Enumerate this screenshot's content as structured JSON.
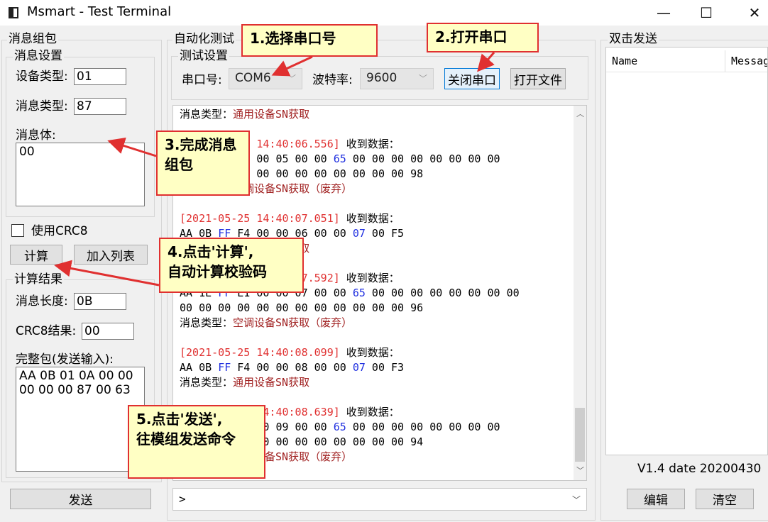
{
  "window": {
    "title": "Msmart - Test Terminal",
    "minimize": "—",
    "maximize": "☐",
    "close": "✕"
  },
  "left": {
    "group_title": "消息组包",
    "settings_title": "消息设置",
    "device_type_label": "设备类型:",
    "device_type_value": "01",
    "msg_type_label": "消息类型:",
    "msg_type_value": "87",
    "msg_body_label": "消息体:",
    "msg_body_value": "00",
    "crc_checkbox_label": "使用CRC8",
    "crc_checked": false,
    "calc_button": "计算",
    "add_list_button": "加入列表",
    "result_title": "计算结果",
    "msg_len_label": "消息长度:",
    "msg_len_value": "0B",
    "crc_result_label": "CRC8结果:",
    "crc_result_value": "00",
    "full_packet_label": "完整包(发送输入):",
    "full_packet_value": "AA 0B 01 0A 00 00\n00 00 00 87 00 63",
    "send_button": "发送"
  },
  "middle": {
    "group_title": "自动化测试",
    "settings_title": "测试设置",
    "port_label": "串口号:",
    "port_value": "COM6",
    "baud_label": "波特率:",
    "baud_value": "9600",
    "close_port_button": "关闭串口",
    "open_file_button": "打开文件",
    "send_input_value": ">"
  },
  "log": [
    {
      "type": "msgtype",
      "prefix": "消息类型：",
      "text": "通用设备SN获取"
    },
    {
      "type": "blank"
    },
    {
      "type": "ts",
      "ts": "[2021-05-25 14:40:06.556]",
      "suffix": " 收到数据："
    },
    {
      "type": "hex",
      "parts": [
        [
          "",
          "AA 1E 01 00 00 05 00 00 "
        ],
        [
          "b",
          "65"
        ],
        [
          "",
          " 00 00 00 00 00 00 00 00"
        ]
      ]
    },
    {
      "type": "hex",
      "parts": [
        [
          "",
          "00 00 00 00 00 00 00 00 00 00 00 00 98"
        ]
      ]
    },
    {
      "type": "msgtype",
      "prefix": "消息类型：",
      "text": "空调设备SN获取（废弃）"
    },
    {
      "type": "blank"
    },
    {
      "type": "ts",
      "ts": "[2021-05-25 14:40:07.051]",
      "suffix": " 收到数据："
    },
    {
      "type": "hex",
      "parts": [
        [
          "",
          "AA 0B "
        ],
        [
          "b",
          "FF"
        ],
        [
          "",
          " F4 00 00 06 00 00 "
        ],
        [
          "b",
          "07"
        ],
        [
          "",
          " 00 F5"
        ]
      ]
    },
    {
      "type": "msgtype",
      "prefix": "消息类型：",
      "text": "通用设备SN获取"
    },
    {
      "type": "blank"
    },
    {
      "type": "ts",
      "ts": "[2021-05-25 14:40:07.592]",
      "suffix": " 收到数据："
    },
    {
      "type": "hex",
      "parts": [
        [
          "",
          "AA 1E "
        ],
        [
          "b",
          "FF"
        ],
        [
          "",
          " E1 00 00 07 00 00 "
        ],
        [
          "b",
          "65"
        ],
        [
          "",
          " 00 00 00 00 00 00 00 00"
        ]
      ]
    },
    {
      "type": "hex",
      "parts": [
        [
          "",
          "00 00 00 00 00 00 00 00 00 00 00 00 96"
        ]
      ]
    },
    {
      "type": "msgtype",
      "prefix": "消息类型：",
      "text": "空调设备SN获取（废弃）"
    },
    {
      "type": "blank"
    },
    {
      "type": "ts",
      "ts": "[2021-05-25 14:40:08.099]",
      "suffix": " 收到数据："
    },
    {
      "type": "hex",
      "parts": [
        [
          "",
          "AA 0B "
        ],
        [
          "b",
          "FF"
        ],
        [
          "",
          " F4 00 00 08 00 00 "
        ],
        [
          "b",
          "07"
        ],
        [
          "",
          " 00 F3"
        ]
      ]
    },
    {
      "type": "msgtype",
      "prefix": "消息类型：",
      "text": "通用设备SN获取"
    },
    {
      "type": "blank"
    },
    {
      "type": "ts",
      "ts": "[2021-05-25 14:40:08.639]",
      "suffix": " 收到数据："
    },
    {
      "type": "hex",
      "parts": [
        [
          "",
          "AA 1E 01 00 00 09 00 00 "
        ],
        [
          "b",
          "65"
        ],
        [
          "",
          " 00 00 00 00 00 00 00 00"
        ]
      ]
    },
    {
      "type": "hex",
      "parts": [
        [
          "",
          "00 00 00 00 00 00 00 00 00 00 00 00 94"
        ]
      ]
    },
    {
      "type": "msgtype",
      "prefix": "消息类型：",
      "text": "空调设备SN获取（废弃）"
    }
  ],
  "right": {
    "group_title": "双击发送",
    "col_name": "Name",
    "col_message": "Message",
    "version": "V1.4 date 20200430",
    "edit_button": "编辑",
    "clear_button": "清空"
  },
  "callouts": {
    "c1": "1.选择串口号",
    "c2": "2.打开串口",
    "c3": "3.完成消息组包",
    "c4": "4.点击'计算',\n自动计算校验码",
    "c5": "5.点击'发送',\n往模组发送命令"
  },
  "colors": {
    "accent_red": "#e03030",
    "callout_bg": "#ffffc4",
    "hex_blue": "#2030e0"
  }
}
